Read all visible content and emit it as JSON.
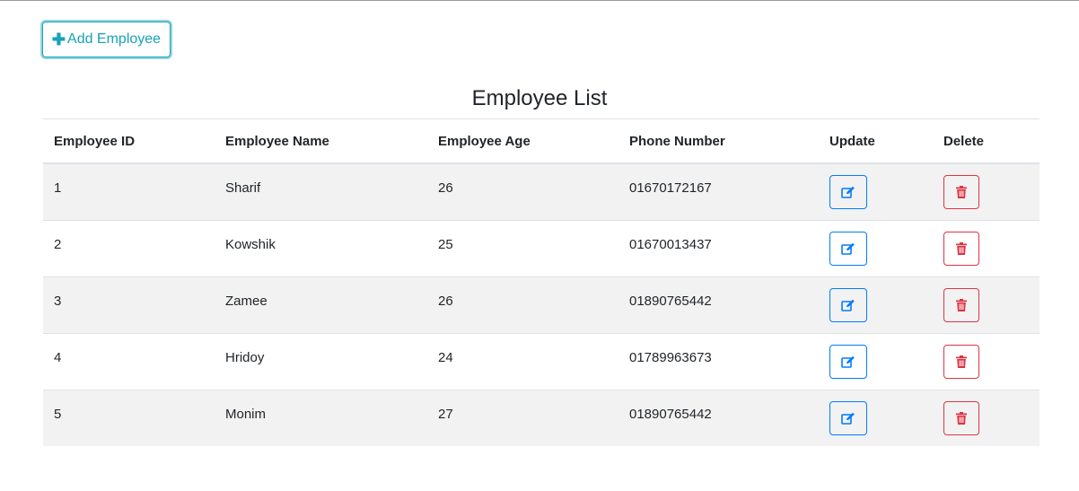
{
  "toolbar": {
    "add_label": "Add Employee",
    "add_icon": "plus-icon",
    "accent_color": "#17a2b8"
  },
  "page": {
    "title": "Employee List"
  },
  "table": {
    "headers": [
      "Employee ID",
      "Employee Name",
      "Employee Age",
      "Phone Number",
      "Update",
      "Delete"
    ],
    "rows": [
      {
        "id": "1",
        "name": "Sharif",
        "age": "26",
        "phone": "01670172167"
      },
      {
        "id": "2",
        "name": "Kowshik",
        "age": "25",
        "phone": "01670013437"
      },
      {
        "id": "3",
        "name": "Zamee",
        "age": "26",
        "phone": "01890765442"
      },
      {
        "id": "4",
        "name": "Hridoy",
        "age": "24",
        "phone": "01789963673"
      },
      {
        "id": "5",
        "name": "Monim",
        "age": "27",
        "phone": "01890765442"
      }
    ],
    "update_icon": "edit-icon",
    "delete_icon": "trash-icon",
    "update_color": "#007bff",
    "delete_color": "#dc3545",
    "stripe_color": "#f2f2f2"
  }
}
